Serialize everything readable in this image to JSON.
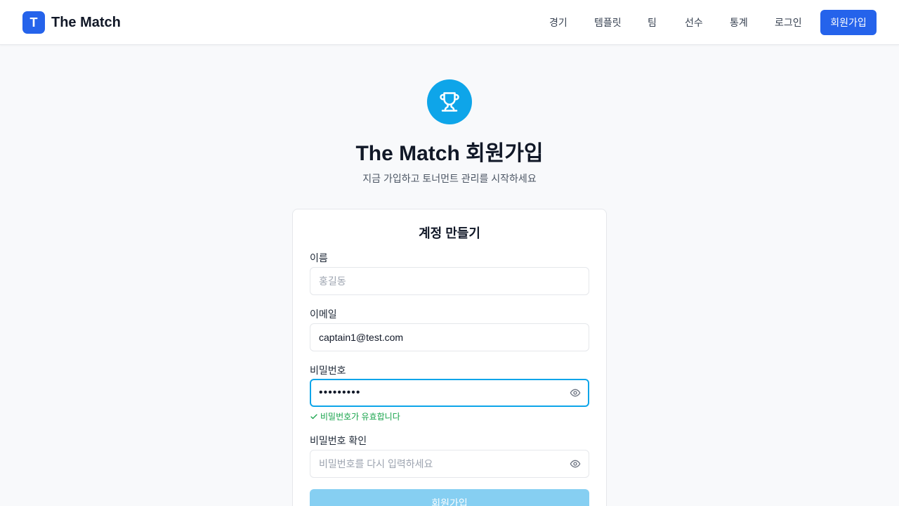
{
  "header": {
    "logo_letter": "T",
    "brand_name": "The Match",
    "nav": [
      {
        "label": "경기"
      },
      {
        "label": "템플릿"
      },
      {
        "label": "팀"
      },
      {
        "label": "선수"
      },
      {
        "label": "통계"
      },
      {
        "label": "로그인"
      }
    ],
    "signup_button": "회원가입",
    "accent_color": "#2563eb"
  },
  "hero": {
    "icon": "trophy-icon",
    "icon_bg_color": "#0ea5e9",
    "title": "The Match 회원가입",
    "subtitle": "지금 가입하고 토너먼트 관리를 시작하세요"
  },
  "form": {
    "title": "계정 만들기",
    "name": {
      "label": "이름",
      "value": "",
      "placeholder": "홍길동"
    },
    "email": {
      "label": "이메일",
      "value": "captain1@test.com",
      "placeholder": ""
    },
    "password": {
      "label": "비밀번호",
      "masked_value": "•••••••••",
      "toggle_icon": "eye-icon"
    },
    "password_valid_message": "비밀번호가 유효합니다",
    "password_confirm": {
      "label": "비밀번호 확인",
      "value": "",
      "placeholder": "비밀번호를 다시 입력하세요",
      "toggle_icon": "eye-icon"
    },
    "submit_button": "회원가입",
    "valid_color": "#16a34a",
    "submit_disabled_color": "#86cff2"
  }
}
